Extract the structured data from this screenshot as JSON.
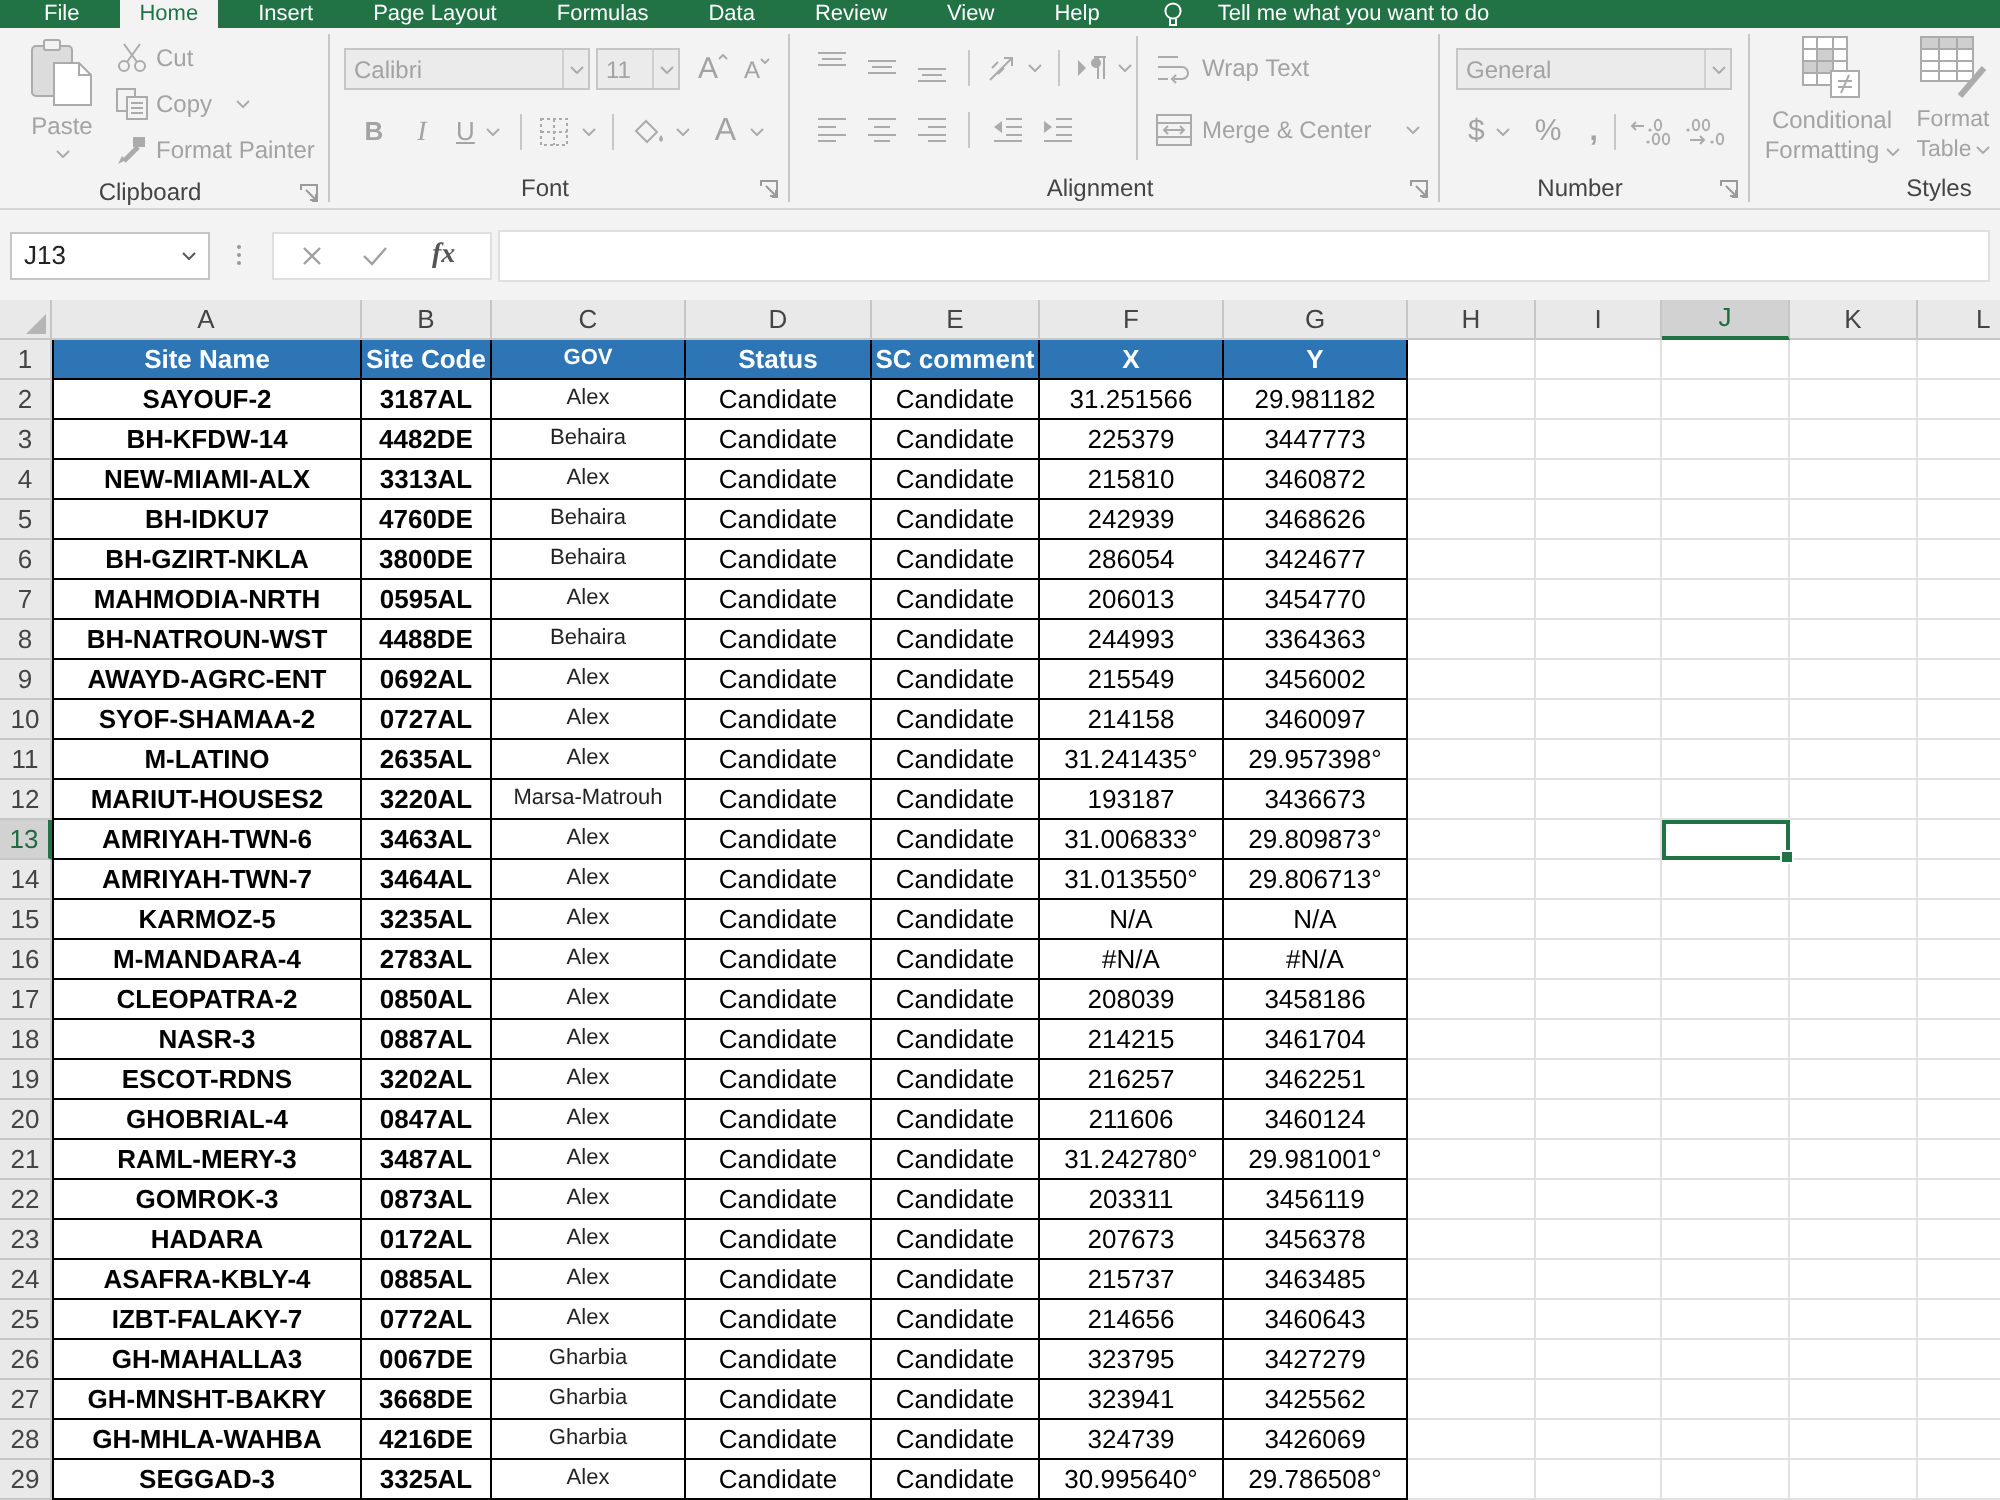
{
  "ribbon_tabs": [
    {
      "label": "File",
      "selected": false
    },
    {
      "label": "Home",
      "selected": true
    },
    {
      "label": "Insert",
      "selected": false
    },
    {
      "label": "Page Layout",
      "selected": false
    },
    {
      "label": "Formulas",
      "selected": false
    },
    {
      "label": "Data",
      "selected": false
    },
    {
      "label": "Review",
      "selected": false
    },
    {
      "label": "View",
      "selected": false
    },
    {
      "label": "Help",
      "selected": false
    }
  ],
  "tell_me": {
    "placeholder": "Tell me what you want to do"
  },
  "ribbon": {
    "commands_disabled": true,
    "clipboard": {
      "label": "Clipboard",
      "paste": "Paste",
      "cut": "Cut",
      "copy": "Copy",
      "format_painter": "Format Painter"
    },
    "font": {
      "label": "Font",
      "font_name": "Calibri",
      "font_size": "11",
      "grow_font": "A",
      "shrink_font": "A",
      "bold": "B",
      "italic": "I",
      "underline": "U",
      "font_color": "A"
    },
    "alignment": {
      "label": "Alignment",
      "wrap_text": "Wrap Text",
      "merge_center": "Merge & Center"
    },
    "number": {
      "label": "Number",
      "format": "General",
      "currency": "$",
      "percent": "%",
      "comma": ","
    },
    "styles": {
      "label": "Styles",
      "conditional_formatting": "Conditional Formatting",
      "format_as_table": "Format Table"
    }
  },
  "formula_bar": {
    "name_box": "J13",
    "function_button": "fx"
  },
  "sheet": {
    "column_headers": [
      {
        "label": "A",
        "selected": false
      },
      {
        "label": "B",
        "selected": false
      },
      {
        "label": "C",
        "selected": false
      },
      {
        "label": "D",
        "selected": false
      },
      {
        "label": "E",
        "selected": false
      },
      {
        "label": "F",
        "selected": false
      },
      {
        "label": "G",
        "selected": false
      },
      {
        "label": "H",
        "selected": false
      },
      {
        "label": "I",
        "selected": false
      },
      {
        "label": "J",
        "selected": true
      },
      {
        "label": "K",
        "selected": false
      },
      {
        "label": "L",
        "selected": false
      }
    ],
    "rows": [
      {
        "label": "1",
        "selected": false,
        "kind": "header",
        "cells": [
          "Site Name",
          "Site Code",
          "GOV",
          "Status",
          "SC comment",
          "X",
          "Y"
        ]
      },
      {
        "label": "2",
        "selected": false,
        "kind": "data",
        "cells": [
          "SAYOUF-2",
          "3187AL",
          "Alex",
          "Candidate",
          "Candidate",
          "31.251566",
          "29.981182"
        ]
      },
      {
        "label": "3",
        "selected": false,
        "kind": "data",
        "cells": [
          "BH-KFDW-14",
          "4482DE",
          "Behaira",
          "Candidate",
          "Candidate",
          "225379",
          "3447773"
        ]
      },
      {
        "label": "4",
        "selected": false,
        "kind": "data",
        "cells": [
          "NEW-MIAMI-ALX",
          "3313AL",
          "Alex",
          "Candidate",
          "Candidate",
          "215810",
          "3460872"
        ]
      },
      {
        "label": "5",
        "selected": false,
        "kind": "data",
        "cells": [
          "BH-IDKU7",
          "4760DE",
          "Behaira",
          "Candidate",
          "Candidate",
          "242939",
          "3468626"
        ]
      },
      {
        "label": "6",
        "selected": false,
        "kind": "data",
        "cells": [
          "BH-GZIRT-NKLA",
          "3800DE",
          "Behaira",
          "Candidate",
          "Candidate",
          "286054",
          "3424677"
        ]
      },
      {
        "label": "7",
        "selected": false,
        "kind": "data",
        "cells": [
          "MAHMODIA-NRTH",
          "0595AL",
          "Alex",
          "Candidate",
          "Candidate",
          "206013",
          "3454770"
        ]
      },
      {
        "label": "8",
        "selected": false,
        "kind": "data",
        "cells": [
          "BH-NATROUN-WST",
          "4488DE",
          "Behaira",
          "Candidate",
          "Candidate",
          "244993",
          "3364363"
        ]
      },
      {
        "label": "9",
        "selected": false,
        "kind": "data",
        "cells": [
          "AWAYD-AGRC-ENT",
          "0692AL",
          "Alex",
          "Candidate",
          "Candidate",
          "215549",
          "3456002"
        ]
      },
      {
        "label": "10",
        "selected": false,
        "kind": "data",
        "cells": [
          "SYOF-SHAMAA-2",
          "0727AL",
          "Alex",
          "Candidate",
          "Candidate",
          "214158",
          "3460097"
        ]
      },
      {
        "label": "11",
        "selected": false,
        "kind": "data",
        "cells": [
          "M-LATINO",
          "2635AL",
          "Alex",
          "Candidate",
          "Candidate",
          "31.241435°",
          "29.957398°"
        ]
      },
      {
        "label": "12",
        "selected": false,
        "kind": "data",
        "cells": [
          "MARIUT-HOUSES2",
          "3220AL",
          "Marsa-Matrouh",
          "Candidate",
          "Candidate",
          "193187",
          "3436673"
        ]
      },
      {
        "label": "13",
        "selected": true,
        "kind": "data",
        "cells": [
          "AMRIYAH-TWN-6",
          "3463AL",
          "Alex",
          "Candidate",
          "Candidate",
          "31.006833°",
          "29.809873°"
        ]
      },
      {
        "label": "14",
        "selected": false,
        "kind": "data",
        "cells": [
          "AMRIYAH-TWN-7",
          "3464AL",
          "Alex",
          "Candidate",
          "Candidate",
          "31.013550°",
          "29.806713°"
        ]
      },
      {
        "label": "15",
        "selected": false,
        "kind": "data",
        "cells": [
          "KARMOZ-5",
          "3235AL",
          "Alex",
          "Candidate",
          "Candidate",
          "N/A",
          "N/A"
        ]
      },
      {
        "label": "16",
        "selected": false,
        "kind": "data",
        "cells": [
          "M-MANDARA-4",
          "2783AL",
          "Alex",
          "Candidate",
          "Candidate",
          "#N/A",
          "#N/A"
        ]
      },
      {
        "label": "17",
        "selected": false,
        "kind": "data",
        "cells": [
          "CLEOPATRA-2",
          "0850AL",
          "Alex",
          "Candidate",
          "Candidate",
          "208039",
          "3458186"
        ]
      },
      {
        "label": "18",
        "selected": false,
        "kind": "data",
        "cells": [
          "NASR-3",
          "0887AL",
          "Alex",
          "Candidate",
          "Candidate",
          "214215",
          "3461704"
        ]
      },
      {
        "label": "19",
        "selected": false,
        "kind": "data",
        "cells": [
          "ESCOT-RDNS",
          "3202AL",
          "Alex",
          "Candidate",
          "Candidate",
          "216257",
          "3462251"
        ]
      },
      {
        "label": "20",
        "selected": false,
        "kind": "data",
        "cells": [
          "GHOBRIAL-4",
          "0847AL",
          "Alex",
          "Candidate",
          "Candidate",
          "211606",
          "3460124"
        ]
      },
      {
        "label": "21",
        "selected": false,
        "kind": "data",
        "cells": [
          "RAML-MERY-3",
          "3487AL",
          "Alex",
          "Candidate",
          "Candidate",
          "31.242780°",
          "29.981001°"
        ]
      },
      {
        "label": "22",
        "selected": false,
        "kind": "data",
        "cells": [
          "GOMROK-3",
          "0873AL",
          "Alex",
          "Candidate",
          "Candidate",
          "203311",
          "3456119"
        ]
      },
      {
        "label": "23",
        "selected": false,
        "kind": "data",
        "cells": [
          "HADARA",
          "0172AL",
          "Alex",
          "Candidate",
          "Candidate",
          "207673",
          "3456378"
        ]
      },
      {
        "label": "24",
        "selected": false,
        "kind": "data",
        "cells": [
          "ASAFRA-KBLY-4",
          "0885AL",
          "Alex",
          "Candidate",
          "Candidate",
          "215737",
          "3463485"
        ]
      },
      {
        "label": "25",
        "selected": false,
        "kind": "data",
        "cells": [
          "IZBT-FALAKY-7",
          "0772AL",
          "Alex",
          "Candidate",
          "Candidate",
          "214656",
          "3460643"
        ]
      },
      {
        "label": "26",
        "selected": false,
        "kind": "data",
        "cells": [
          "GH-MAHALLA3",
          "0067DE",
          "Gharbia",
          "Candidate",
          "Candidate",
          "323795",
          "3427279"
        ]
      },
      {
        "label": "27",
        "selected": false,
        "kind": "data",
        "cells": [
          "GH-MNSHT-BAKRY",
          "3668DE",
          "Gharbia",
          "Candidate",
          "Candidate",
          "323941",
          "3425562"
        ]
      },
      {
        "label": "28",
        "selected": false,
        "kind": "data",
        "cells": [
          "GH-MHLA-WAHBA",
          "4216DE",
          "Gharbia",
          "Candidate",
          "Candidate",
          "324739",
          "3426069"
        ]
      },
      {
        "label": "29",
        "selected": false,
        "kind": "data",
        "cells": [
          "SEGGAD-3",
          "3325AL",
          "Alex",
          "Candidate",
          "Candidate",
          "30.995640°",
          "29.786508°"
        ]
      }
    ]
  }
}
